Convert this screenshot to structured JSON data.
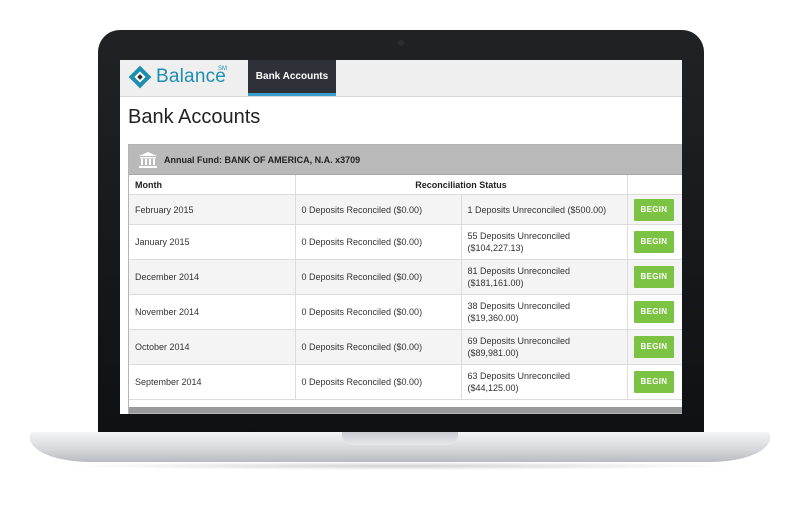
{
  "app": {
    "logo_text": "Balance",
    "logo_mark_suffix": "SM",
    "nav_tab": "Bank Accounts"
  },
  "page": {
    "title": "Bank Accounts"
  },
  "account": {
    "header": "Annual Fund: BANK OF AMERICA, N.A. x3709",
    "icon": "bank-icon"
  },
  "table": {
    "headers": {
      "month": "Month",
      "status": "Reconciliation Status"
    },
    "rows": [
      {
        "month": "February 2015",
        "reconciled": "0 Deposits Reconciled ($0.00)",
        "unreconciled": "1 Deposits Unreconciled ($500.00)",
        "action": "BEGIN"
      },
      {
        "month": "January 2015",
        "reconciled": "0 Deposits Reconciled ($0.00)",
        "unreconciled": "55 Deposits Unreconciled ($104,227.13)",
        "action": "BEGIN"
      },
      {
        "month": "December 2014",
        "reconciled": "0 Deposits Reconciled ($0.00)",
        "unreconciled": "81 Deposits Unreconciled ($181,161.00)",
        "action": "BEGIN"
      },
      {
        "month": "November 2014",
        "reconciled": "0 Deposits Reconciled ($0.00)",
        "unreconciled": "38 Deposits Unreconciled ($19,360.00)",
        "action": "BEGIN"
      },
      {
        "month": "October 2014",
        "reconciled": "0 Deposits Reconciled ($0.00)",
        "unreconciled": "69 Deposits Unreconciled ($89,981.00)",
        "action": "BEGIN"
      },
      {
        "month": "September 2014",
        "reconciled": "0 Deposits Reconciled ($0.00)",
        "unreconciled": "63 Deposits Unreconciled ($44,125.00)",
        "action": "BEGIN"
      }
    ]
  },
  "colors": {
    "brand": "#1c8fb0",
    "nav_dark": "#2f3138",
    "begin_button": "#7cc243",
    "panel_header": "#b9b9b9"
  }
}
